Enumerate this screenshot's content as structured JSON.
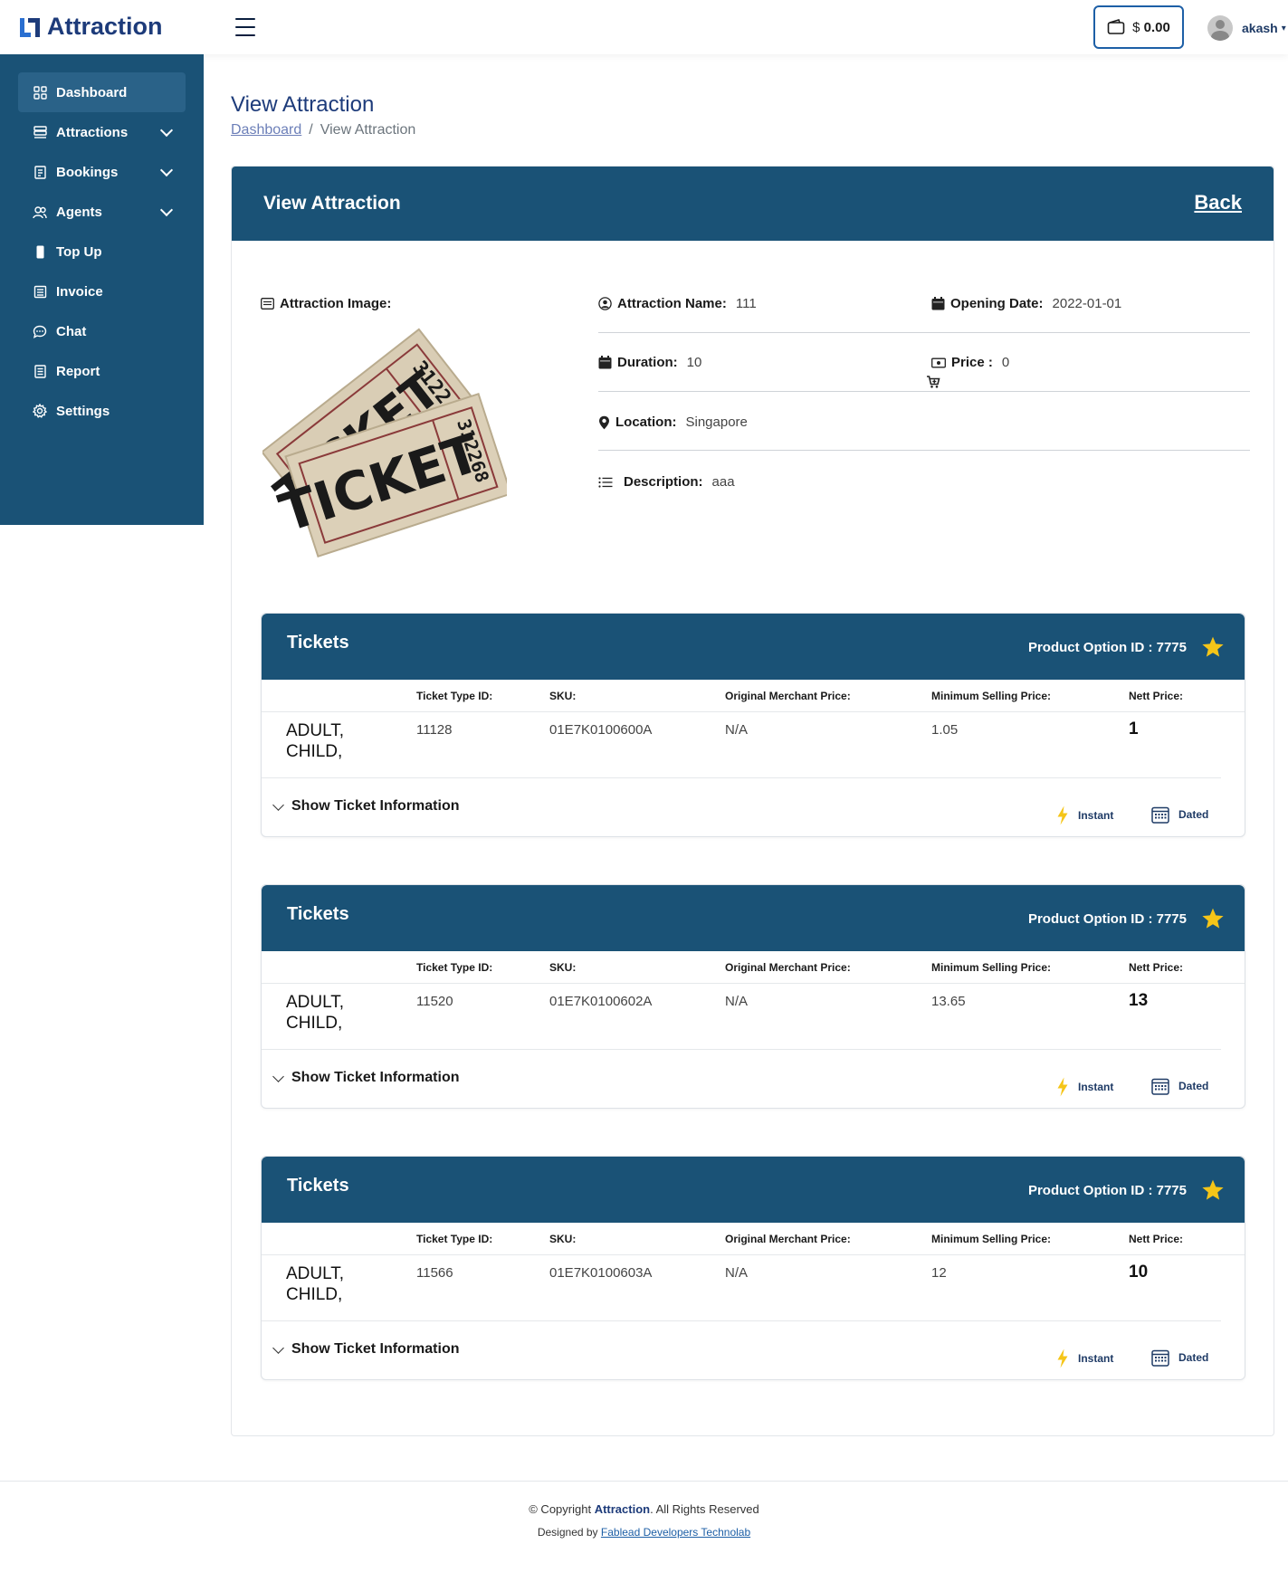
{
  "brand": {
    "name": "Attraction"
  },
  "header": {
    "wallet_currency": "$",
    "wallet_amount": "0.00",
    "user_name": "akash"
  },
  "sidebar": {
    "items": [
      {
        "label": "Dashboard",
        "icon": "grid-icon"
      },
      {
        "label": "Attractions",
        "icon": "list-icon"
      },
      {
        "label": "Bookings",
        "icon": "document-icon"
      },
      {
        "label": "Agents",
        "icon": "users-icon"
      },
      {
        "label": "Top Up",
        "icon": "phone-icon"
      },
      {
        "label": "Invoice",
        "icon": "invoice-icon"
      },
      {
        "label": "Chat",
        "icon": "chat-icon"
      },
      {
        "label": "Report",
        "icon": "report-icon"
      },
      {
        "label": "Settings",
        "icon": "gear-icon"
      }
    ]
  },
  "page": {
    "title": "View Attraction",
    "breadcrumb_home": "Dashboard",
    "breadcrumb_sep": "/",
    "breadcrumb_current": "View Attraction"
  },
  "card": {
    "title": "View Attraction",
    "back_label": "Back"
  },
  "details": {
    "image_label": "Attraction Image:",
    "image_text": "TICKET",
    "image_number_back": "3122",
    "image_number_front": "312268",
    "name_label": "Attraction Name:",
    "name_value": "111",
    "opening_label": "Opening Date:",
    "opening_value": "2022-01-01",
    "duration_label": "Duration:",
    "duration_value": "10",
    "price_label": "Price :",
    "price_value": "0",
    "location_label": "Location:",
    "location_value": "Singapore",
    "description_label": "Description:",
    "description_value": "aaa"
  },
  "ticket_headers": {
    "type_id": "Ticket Type ID:",
    "sku": "SKU:",
    "omp": "Original Merchant Price:",
    "msp": "Minimum Selling Price:",
    "nett": "Nett Price:"
  },
  "tickets": [
    {
      "title": "Tickets",
      "product_option": "Product Option ID : 7775",
      "type_line1": "ADULT,",
      "type_line2": "CHILD,",
      "type_id": "11128",
      "sku": "01E7K0100600A",
      "omp": "N/A",
      "msp": "1.05",
      "nett": "1",
      "show_info": "Show Ticket Information",
      "instant": "Instant",
      "dated": "Dated"
    },
    {
      "title": "Tickets",
      "product_option": "Product Option ID : 7775",
      "type_line1": "ADULT,",
      "type_line2": "CHILD,",
      "type_id": "11520",
      "sku": "01E7K0100602A",
      "omp": "N/A",
      "msp": "13.65",
      "nett": "13",
      "show_info": "Show Ticket Information",
      "instant": "Instant",
      "dated": "Dated"
    },
    {
      "title": "Tickets",
      "product_option": "Product Option ID : 7775",
      "type_line1": "ADULT,",
      "type_line2": "CHILD,",
      "type_id": "11566",
      "sku": "01E7K0100603A",
      "omp": "N/A",
      "msp": "12",
      "nett": "10",
      "show_info": "Show Ticket Information",
      "instant": "Instant",
      "dated": "Dated"
    }
  ],
  "footer": {
    "copyright_prefix": "© Copyright",
    "copyright_brand": "Attraction",
    "copyright_suffix": ". All Rights Reserved",
    "designed_prefix": "Designed by",
    "designed_link": "Fablead Developers Technolab"
  },
  "colors": {
    "primary": "#1a5276",
    "brand_text": "#1d3b7a",
    "star": "#f5c518",
    "bolt": "#f5c518"
  }
}
